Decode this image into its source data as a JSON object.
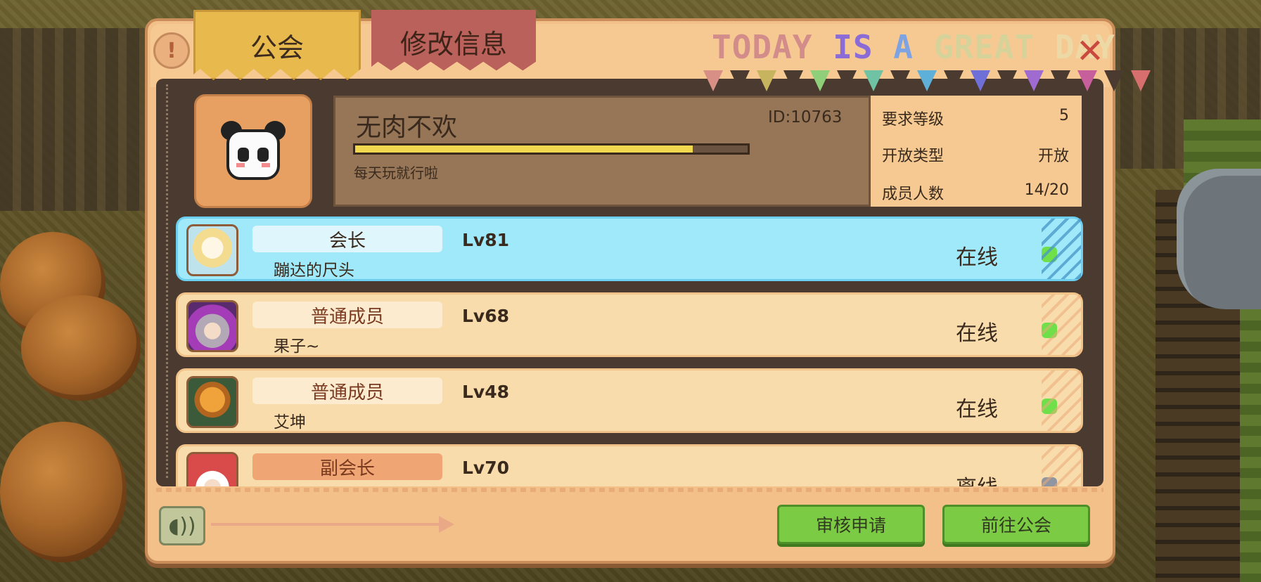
{
  "tabs": {
    "guild": "公会",
    "edit_info": "修改信息"
  },
  "banner": {
    "w1": "TODAY",
    "w2": "IS",
    "w3": "A",
    "w4": "GREAT",
    "w5": "DAY"
  },
  "buttons": {
    "help": "!",
    "close": "✕",
    "voice": "◖))",
    "review": "审核申请",
    "goto": "前往公会"
  },
  "guild": {
    "name": "无肉不欢",
    "id": "ID:10763",
    "motto": "每天玩就行啦",
    "exp_progress": 0.86,
    "avatar_icon": "panda-icon",
    "stats": [
      {
        "label": "要求等级",
        "value": "5"
      },
      {
        "label": "开放类型",
        "value": "开放"
      },
      {
        "label": "成员人数",
        "value": "14/20"
      }
    ]
  },
  "members": [
    {
      "role": "会长",
      "name": "蹦达的尺头",
      "level": "Lv81",
      "status": "在线",
      "online": true,
      "selected": true,
      "portrait": "cat-portrait"
    },
    {
      "role": "普通成员",
      "name": "果子~",
      "level": "Lv68",
      "status": "在线",
      "online": true,
      "selected": false,
      "portrait": "girl-portrait"
    },
    {
      "role": "普通成员",
      "name": "艾坤",
      "level": "Lv48",
      "status": "在线",
      "online": true,
      "selected": false,
      "portrait": "pumpkin-portrait"
    },
    {
      "role": "副会长",
      "name": "",
      "level": "Lv70",
      "status": "离线",
      "online": false,
      "selected": false,
      "portrait": "deputy-portrait"
    }
  ],
  "colors": {
    "online": "#6fe04a",
    "offline": "#8f96a2",
    "role_leader_bg": "#dff6fd",
    "role_member_bg": "#fcebcf",
    "role_deputy_bg": "#f0a574",
    "role_text_leader": "#3a2a1d",
    "role_text_member": "#7a3a20"
  }
}
